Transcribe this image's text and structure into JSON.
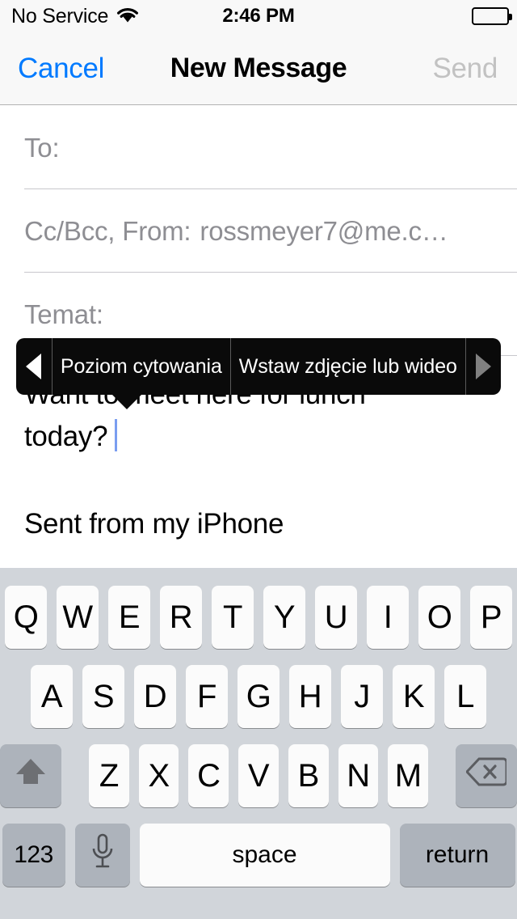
{
  "status_bar": {
    "carrier": "No Service",
    "wifi_icon": "wifi-icon",
    "time": "2:46 PM",
    "battery_icon": "battery-full-icon"
  },
  "nav_bar": {
    "cancel_label": "Cancel",
    "title": "New Message",
    "send_label": "Send",
    "cancel_color": "#007aff",
    "send_color": "#c2c2c2"
  },
  "compose": {
    "to": {
      "label": "To:",
      "value": ""
    },
    "cc_bcc_from": {
      "label": "Cc/Bcc, From:",
      "value": "rossmeyer7@me.c…"
    },
    "subject": {
      "label": "Temat:",
      "value": ""
    },
    "body": {
      "line1": "Want to meet here for lunch",
      "line2": "today?",
      "signature": "Sent from my iPhone"
    }
  },
  "edit_popup": {
    "prev_arrow_icon": "triangle-left-icon",
    "next_arrow_icon": "triangle-right-icon",
    "items": [
      {
        "label": "Poziom cytowania"
      },
      {
        "label": "Wstaw zdjęcie lub wideo"
      }
    ],
    "background_color": "#0a0a0a",
    "prev_arrow_color": "#ffffff",
    "next_arrow_color": "#808080"
  },
  "keyboard": {
    "background_color": "#d1d5da",
    "row1": [
      "Q",
      "W",
      "E",
      "R",
      "T",
      "Y",
      "U",
      "I",
      "O",
      "P"
    ],
    "row2": [
      "A",
      "S",
      "D",
      "F",
      "G",
      "H",
      "J",
      "K",
      "L"
    ],
    "row3_letters": [
      "Z",
      "X",
      "C",
      "V",
      "B",
      "N",
      "M"
    ],
    "shift_icon": "shift-arrow-up-icon",
    "backspace_icon": "backspace-delete-icon",
    "numbers_label": "123",
    "mic_icon": "microphone-icon",
    "space_label": "space",
    "return_label": "return"
  }
}
